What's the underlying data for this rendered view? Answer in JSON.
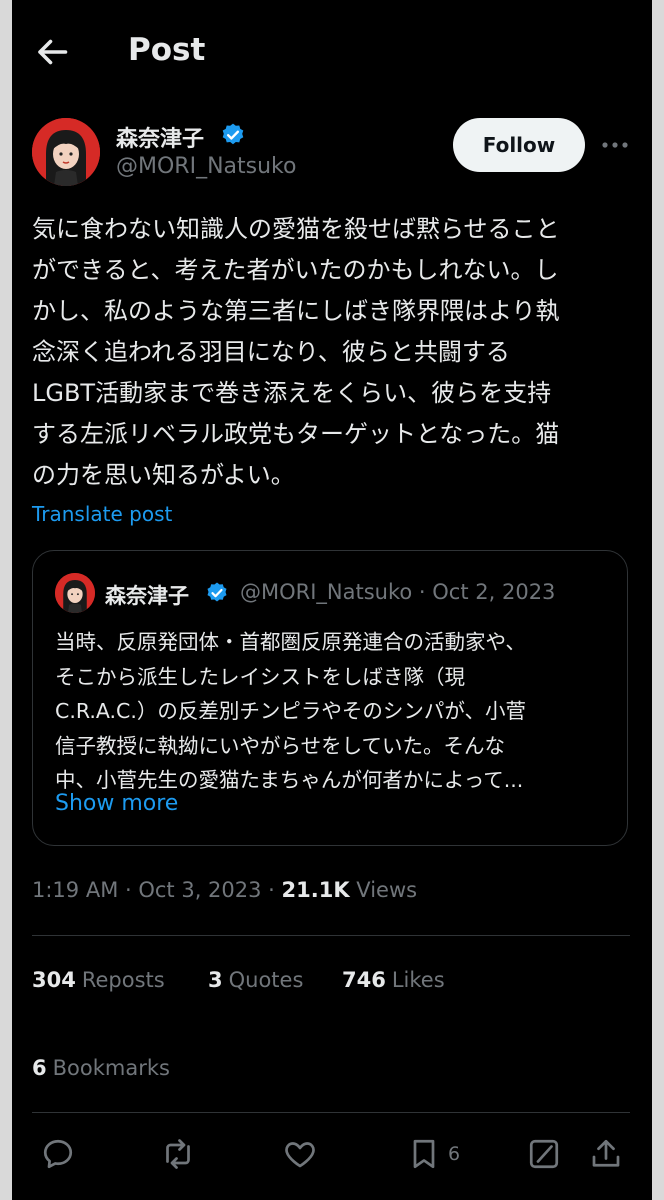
{
  "header": {
    "back_icon": "arrow-left-icon",
    "title": "Post"
  },
  "author": {
    "display_name": "森奈津子",
    "handle": "@MORI_Natsuko",
    "verified_icon": "verified-badge-icon",
    "follow_label": "Follow",
    "more_icon": "more-horizontal-icon"
  },
  "post": {
    "text": "気に食わない知識人の愛猫を殺せば黙らせること\nができると、考えた者がいたのかもしれない。し\nかし、私のような第三者にしばき隊界隈はより執\n念深く追われる羽目になり、彼らと共闘する\nLGBT活動家まで巻き添えをくらい、彼らを支持\nする左派リベラル政党もターゲットとなった。猫\nの力を思い知るがよい。",
    "translate_label": "Translate post"
  },
  "quote": {
    "display_name": "森奈津子",
    "meta": "@MORI_Natsuko · Oct 2, 2023",
    "text": "当時、反原発団体・首都圏反原発連合の活動家や、\nそこから派生したレイシストをしばき隊（現\nC.R.A.C.）の反差別チンピラやそのシンパが、小菅\n信子教授に執拗にいやがらせをしていた。そんな\n中、小菅先生の愛猫たまちゃんが何者かによって...",
    "show_more_label": "Show more"
  },
  "timestamp": {
    "time_date": "1:19 AM · Oct 3, 2023 · ",
    "views_count": "21.1K",
    "views_label": " Views"
  },
  "stats": {
    "reposts_count": "304",
    "reposts_label": "Reposts",
    "quotes_count": "3",
    "quotes_label": "Quotes",
    "likes_count": "746",
    "likes_label": "Likes",
    "bookmarks_count": "6",
    "bookmarks_label": "Bookmarks"
  },
  "actions": {
    "reply_icon": "reply-icon",
    "repost_icon": "repost-icon",
    "like_icon": "like-icon",
    "bookmark_icon": "bookmark-icon",
    "bookmark_count": "6",
    "grok_icon": "grok-icon",
    "share_icon": "share-icon"
  },
  "colors": {
    "background": "#000000",
    "text": "#e7e9ea",
    "muted": "#71767b",
    "accent": "#1d9bf0",
    "border": "#2f3336"
  }
}
